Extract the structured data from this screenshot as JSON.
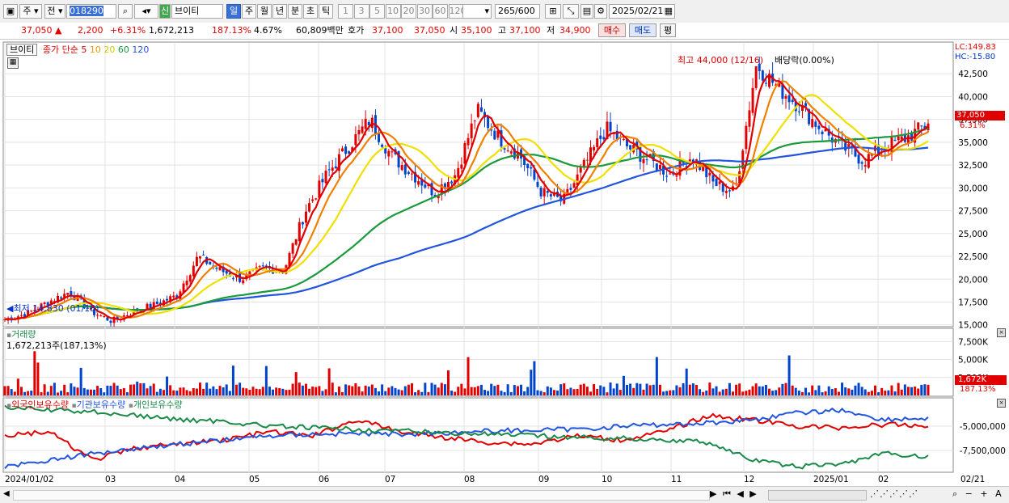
{
  "toolbar": {
    "market_label": "주",
    "prev_label": "전",
    "code_value": "018290",
    "name_badge": "신",
    "stock_name": "브이티",
    "period_tabs": [
      "일",
      "주",
      "월",
      "년",
      "분",
      "초",
      "틱"
    ],
    "selected_period": "일",
    "interval_buttons": [
      "1",
      "3",
      "5",
      "10",
      "20",
      "30",
      "60",
      "120"
    ],
    "count_value": "265",
    "count_max": "/600",
    "date_value": "2025/02/21"
  },
  "quote": {
    "price": "37,050",
    "change": "2,200",
    "change_pct": "+6.31%",
    "volume": "1,672,213",
    "volume_ratio": "187.13%",
    "turnover": "4.67%",
    "amount": "60,809백만",
    "ask_label": "호가",
    "ask1": "37,100",
    "ask2": "37,050",
    "open_label": "시",
    "open": "35,100",
    "high_label": "고",
    "high": "37,100",
    "low_label": "저",
    "low": "34,900",
    "buy_button": "매수",
    "sell_button": "매도",
    "avg_button": "평"
  },
  "price_panel": {
    "stock_tag": "브이티",
    "ma_label": "종가 단순",
    "ma_periods": [
      "5",
      "10",
      "20",
      "60",
      "120"
    ],
    "ma_colors": [
      "#e00000",
      "#f08000",
      "#f0e000",
      "#1a9a3a",
      "#2255dd"
    ],
    "lc_label": "LC:149.83",
    "hc_label": "HC:-15.80",
    "high_annotation": "최고 44,000 (12/16)",
    "drop_annotation": "배당락(0.00%)",
    "low_annotation": "최저 14,830 (01/18)",
    "last_price_tag": "37,050",
    "last_pct_tag": "6.31%",
    "y_ticks": [
      "42,500",
      "40,000",
      "37,500",
      "35,000",
      "32,500",
      "30,000",
      "27,500",
      "25,000",
      "22,500",
      "20,000",
      "17,500",
      "15,000"
    ]
  },
  "volume_panel": {
    "title": "거래량",
    "value_label": "1,672,213주(187,13%)",
    "y_ticks": [
      "7,500K",
      "5,000K",
      "2,500K"
    ],
    "last_tag": "1,672K",
    "last_pct_tag": "187.13%"
  },
  "holding_panel": {
    "series_labels": [
      "외국인보유수량",
      "기관보유수량",
      "개인보유수량"
    ],
    "series_colors": [
      "#e00000",
      "#2255dd",
      "#1a8a4a"
    ],
    "y_ticks": [
      "-5,000,000",
      "-7,500,000"
    ]
  },
  "x_axis": {
    "labels": [
      "2024/01/02",
      "03",
      "04",
      "05",
      "06",
      "07",
      "08",
      "09",
      "10",
      "11",
      "12",
      "2025/01",
      "02"
    ],
    "right_label": "02/21"
  },
  "chart_data": {
    "type": "candlestick",
    "title": "브이티",
    "ylabel": "",
    "ylim": [
      14000,
      45000
    ],
    "x_range": [
      "2024/01/02",
      "2025/02/21"
    ],
    "grid": true,
    "price_series": {
      "name": "종가",
      "approx_closes": [
        15600,
        16200,
        17500,
        18600,
        16500,
        15400,
        16500,
        17200,
        18200,
        22500,
        21000,
        20000,
        21200,
        21000,
        27500,
        31500,
        34500,
        37500,
        33500,
        31500,
        29500,
        31500,
        38500,
        35500,
        33500,
        29500,
        28500,
        32500,
        36500,
        34500,
        33000,
        31500,
        33500,
        30500,
        29500,
        43500,
        41000,
        39000,
        36500,
        34500,
        33000,
        34500,
        35500,
        37050
      ]
    },
    "moving_averages": [
      {
        "name": "5",
        "color": "#e00000"
      },
      {
        "name": "10",
        "color": "#f08000"
      },
      {
        "name": "20",
        "color": "#f0e000"
      },
      {
        "name": "60",
        "color": "#1a9a3a"
      },
      {
        "name": "120",
        "color": "#2255dd"
      }
    ],
    "annotations": [
      {
        "label": "최고 44,000 (12/16)",
        "value": 44000
      },
      {
        "label": "최저 14,830 (01/18)",
        "value": 14830
      },
      {
        "label": "배당락(0.00%)"
      }
    ],
    "last": {
      "close": 37050,
      "open": 35100,
      "high": 37100,
      "low": 34900,
      "change": 2200,
      "change_pct": 6.31,
      "volume": 1672213
    }
  }
}
